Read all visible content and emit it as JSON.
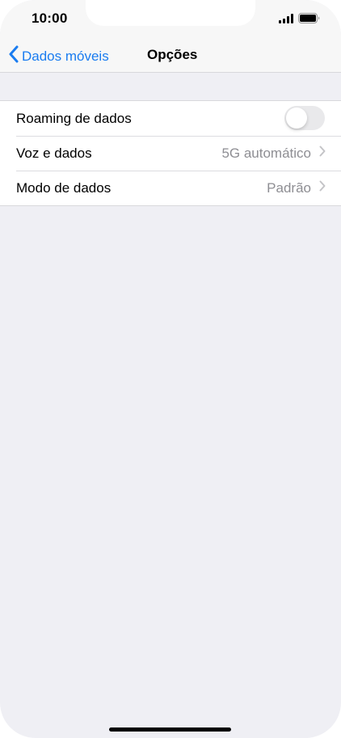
{
  "status_bar": {
    "time": "10:00",
    "icons": [
      "cellular-signal-icon",
      "battery-icon"
    ]
  },
  "nav": {
    "back_label": "Dados móveis",
    "title": "Opções"
  },
  "rows": [
    {
      "label": "Roaming de dados",
      "toggle": false
    },
    {
      "label": "Voz e dados",
      "value": "5G automático",
      "chevron": true
    },
    {
      "label": "Modo de dados",
      "value": "Padrão",
      "chevron": true
    }
  ],
  "colors": {
    "accent": "#1a7cf0",
    "background": "#efeff4",
    "secondary_text": "#8e8e93",
    "toggle_off": "#e9e9eb"
  }
}
